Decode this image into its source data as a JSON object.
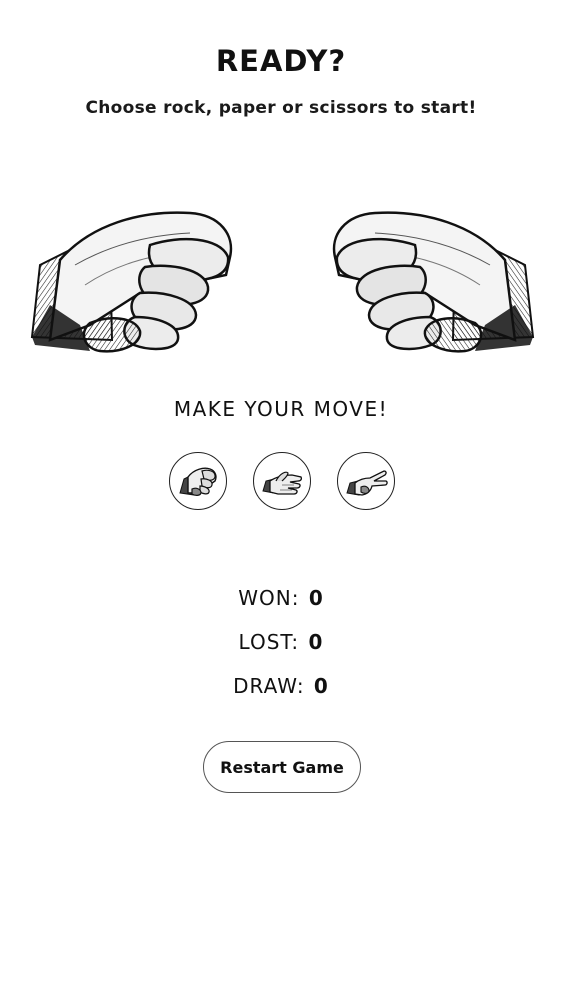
{
  "header": {
    "title": "READY?",
    "subtitle": "Choose rock, paper or scissors to start!"
  },
  "arena": {
    "player_hand": "rock",
    "computer_hand": "rock"
  },
  "moves": {
    "prompt": "MAKE YOUR MOVE!",
    "options": [
      {
        "name": "rock",
        "icon": "rock-hand-icon"
      },
      {
        "name": "paper",
        "icon": "paper-hand-icon"
      },
      {
        "name": "scissors",
        "icon": "scissors-hand-icon"
      }
    ]
  },
  "score": {
    "won_label": "WON:",
    "won": "0",
    "lost_label": "LOST:",
    "lost": "0",
    "draw_label": "DRAW:",
    "draw": "0"
  },
  "controls": {
    "restart_label": "Restart Game"
  }
}
